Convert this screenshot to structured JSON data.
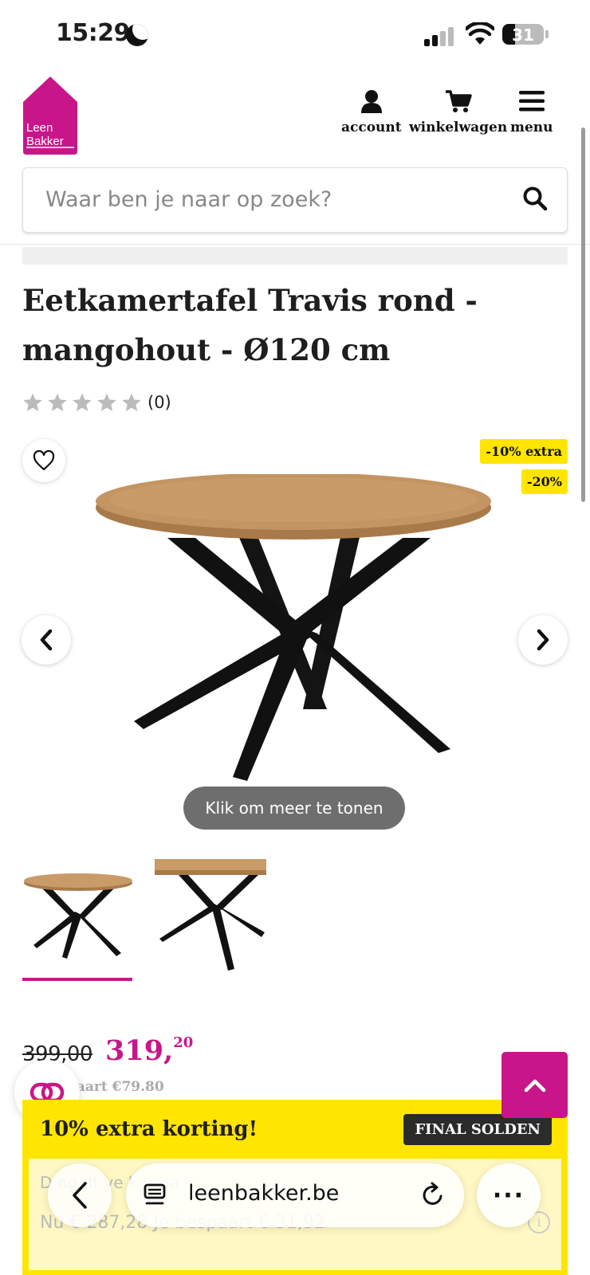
{
  "status_bar": {
    "time": "15:29",
    "battery": "31"
  },
  "header": {
    "logo_line1": "Leen",
    "logo_line2": "Bakker",
    "nav": [
      {
        "label": "account",
        "icon": "user-icon"
      },
      {
        "label": "winkelwagen",
        "icon": "cart-icon"
      },
      {
        "label": "menu",
        "icon": "hamburger-icon"
      }
    ],
    "search_placeholder": "Waar ben je naar op zoek?"
  },
  "product": {
    "title": "Eetkamertafel Travis rond - mangohout - Ø120 cm",
    "rating_stars": 0,
    "rating_count": "(0)",
    "badges": [
      "-10% extra",
      "-20%"
    ],
    "image_button": "Klik om meer te tonen",
    "thumbnails_count": 2,
    "active_thumbnail": 1
  },
  "price": {
    "old": "399,00",
    "new_whole": "319,",
    "new_cents": "20",
    "saving": "paart €79.80"
  },
  "promo": {
    "title": "10% extra korting!",
    "tag": "FINAL SOLDEN",
    "line1": "D     ng  dt ve           k    lewa  ",
    "line2": "Nu € 287,28   Je bespaart € 31,92"
  },
  "browser": {
    "domain": "leenbakker.be",
    "more": "···"
  },
  "colors": {
    "brand": "#c8168a",
    "promo_yellow": "#ffe500"
  }
}
